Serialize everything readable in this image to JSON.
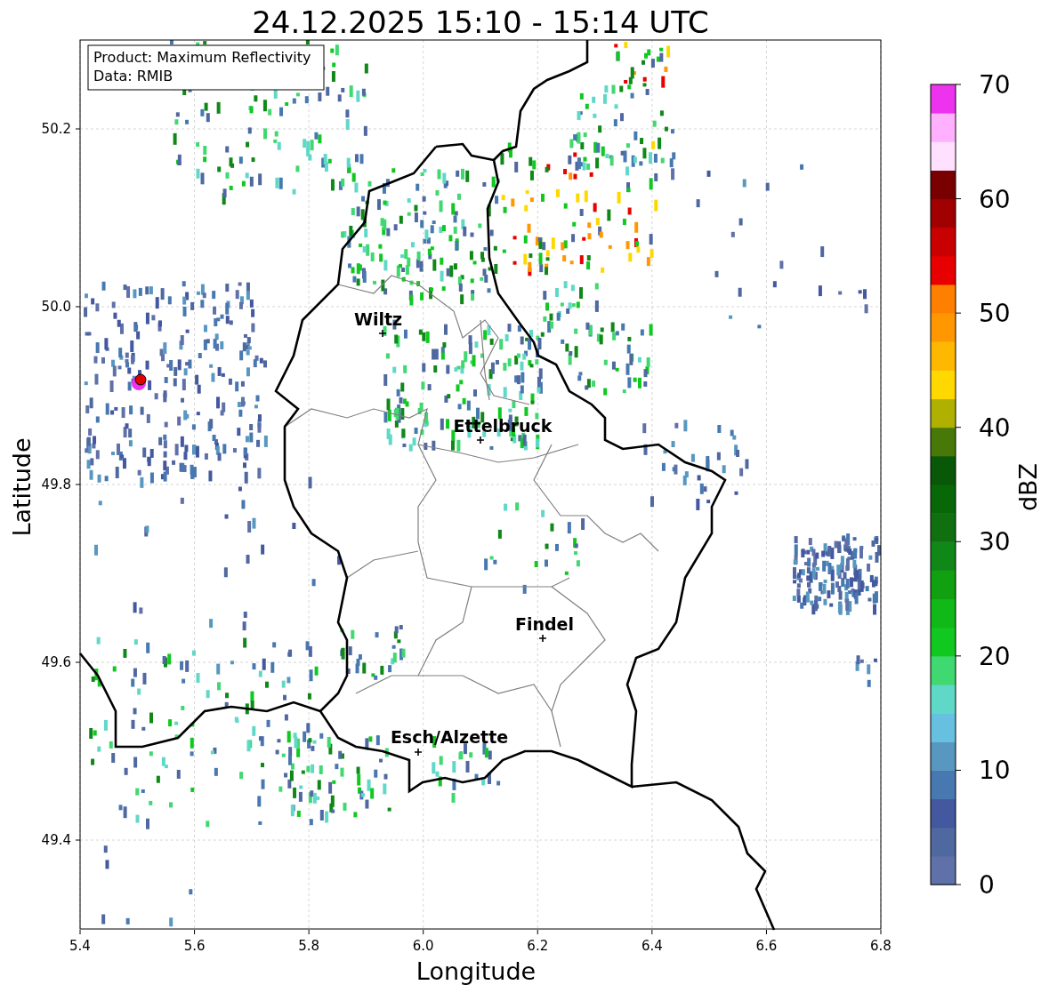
{
  "title": "24.12.2025 15:10 - 15:14 UTC",
  "info_box": {
    "lines": [
      "Product: Maximum Reflectivity",
      "Data: RMIB"
    ]
  },
  "map": {
    "xlabel": "Longitude",
    "ylabel": "Latitude",
    "xticks": [
      "5.4",
      "5.6",
      "5.8",
      "6.0",
      "6.2",
      "6.4",
      "6.6",
      "6.8"
    ],
    "yticks": [
      "50.2",
      "50.0",
      "49.8",
      "49.6",
      "49.4"
    ],
    "places": [
      {
        "name": "Wiltz"
      },
      {
        "name": "Ettelbruck"
      },
      {
        "name": "Findel"
      },
      {
        "name": "Esch/Alzette"
      }
    ]
  },
  "colorbar": {
    "label": "dBZ",
    "ticks": [
      "70",
      "60",
      "50",
      "40",
      "30",
      "20",
      "10",
      "0"
    ]
  }
}
